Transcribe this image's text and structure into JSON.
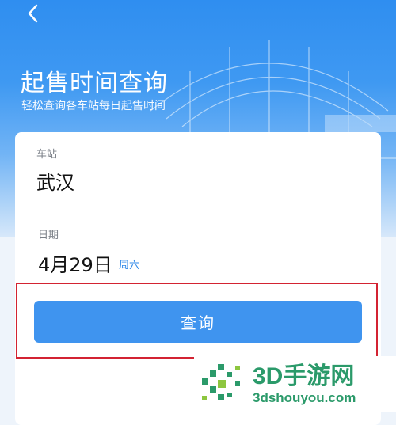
{
  "header": {
    "title": "起售时间查询",
    "subtitle": "轻松查询各车站每日起售时间"
  },
  "form": {
    "station_label": "车站",
    "station_value": "武汉",
    "date_label": "日期",
    "date_value": "4月29日",
    "weekday": "周六",
    "query_button": "查询"
  },
  "watermark": {
    "brand": "3D手游网",
    "url": "3dshouyou.com"
  },
  "colors": {
    "header_blue": "#2f8ef0",
    "button_blue": "#3f94ef",
    "weekday_blue": "#2f88e8",
    "highlight_red": "#d32332",
    "watermark_green": "#2b9a6a"
  },
  "icons": {
    "back": "chevron-left-icon"
  }
}
